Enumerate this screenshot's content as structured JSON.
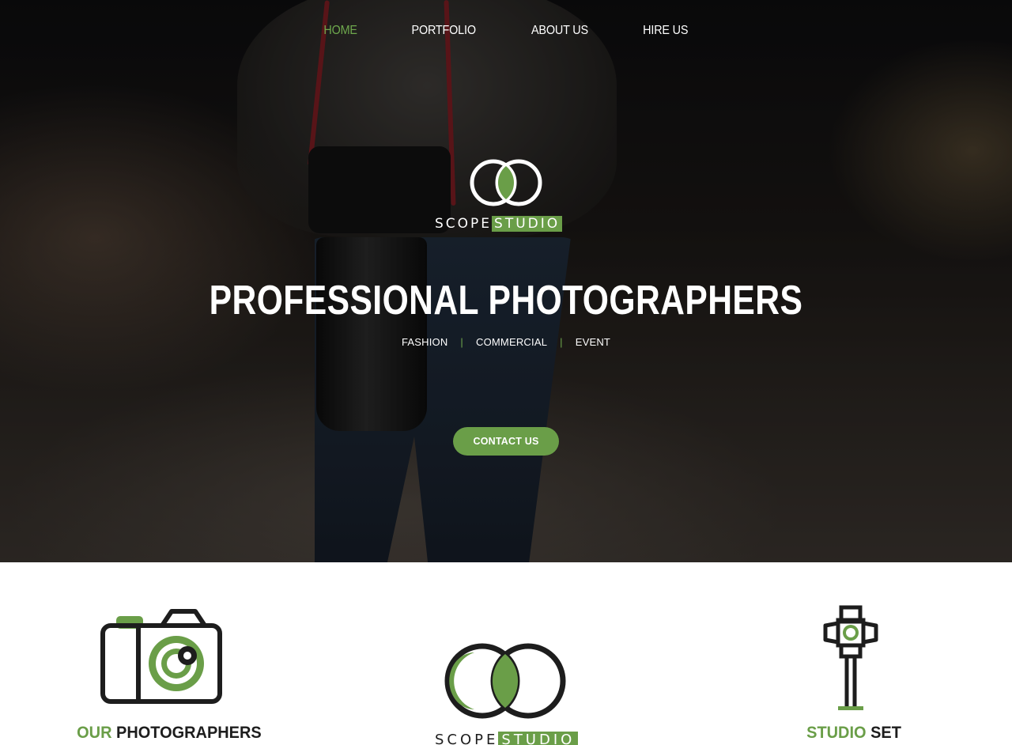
{
  "nav": {
    "items": [
      {
        "label": "HOME",
        "active": true
      },
      {
        "label": "PORTFOLIO",
        "active": false
      },
      {
        "label": "ABOUT US",
        "active": false
      },
      {
        "label": "HIRE US",
        "active": false
      }
    ]
  },
  "brand": {
    "scope": "SCOPE",
    "studio": "STUDIO",
    "accent_color": "#6a9e48"
  },
  "hero": {
    "title": "PROFESSIONAL PHOTOGRAPHERS",
    "tags": [
      "FASHION",
      "COMMERCIAL",
      "EVENT"
    ],
    "tag_separator": "|",
    "cta_label": "CONTACT US"
  },
  "features": {
    "photographers": {
      "accent": "OUR",
      "rest": "PHOTOGRAPHERS",
      "icon": "camera-icon"
    },
    "studio_set": {
      "accent": "STUDIO",
      "rest": "SET",
      "icon": "studio-light-icon"
    },
    "center_logo": {
      "scope": "SCOPE",
      "studio": "STUDIO",
      "icon": "scope-rings-icon"
    }
  }
}
